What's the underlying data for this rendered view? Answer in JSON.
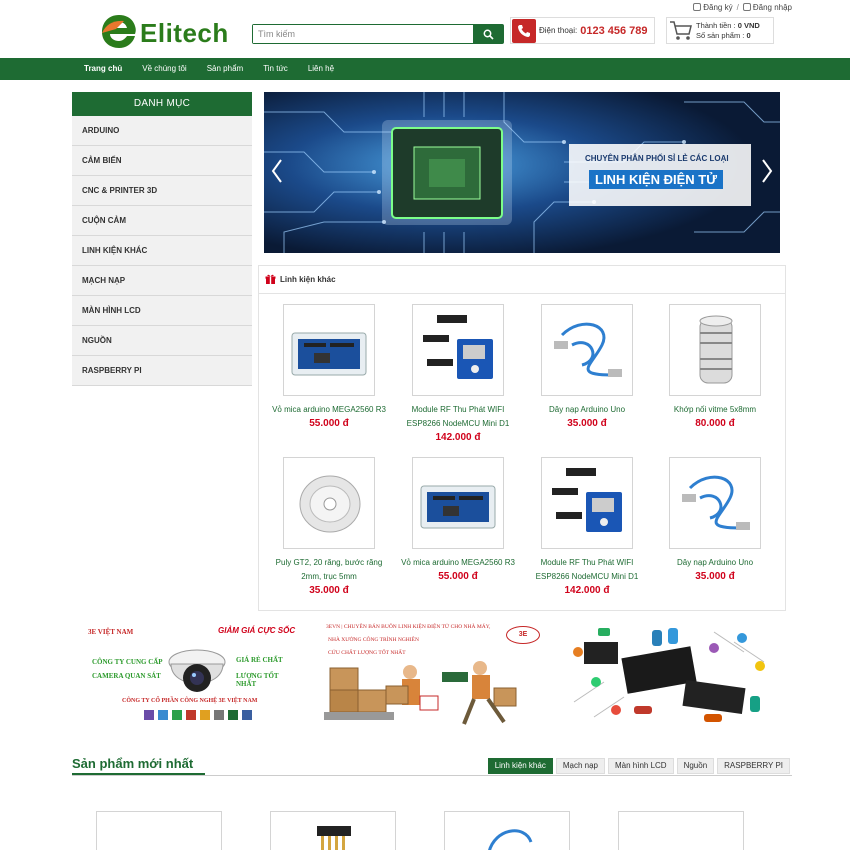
{
  "top_links": {
    "register": "Đăng ký",
    "separator": "/",
    "login": "Đăng nhập"
  },
  "header": {
    "logo_text": "Elitech",
    "search_placeholder": "Tìm kiếm",
    "phone_label": "Điện thoại:",
    "phone_number": "0123 456 789",
    "cart_total_label": "Thành tiền :",
    "cart_total_value": "0 VND",
    "cart_count_label": "Số sản phẩm :",
    "cart_count_value": "0"
  },
  "nav": [
    "Trang chủ",
    "Về chúng tôi",
    "Sản phẩm",
    "Tin tức",
    "Liên hệ"
  ],
  "sidebar": {
    "title": "DANH MỤC",
    "items": [
      "ARDUINO",
      "CẢM BIẾN",
      "CNC & PRINTER 3D",
      "CUỘN CẢM",
      "LINH KIỆN KHÁC",
      "MẠCH NẠP",
      "MÀN HÌNH LCD",
      "NGUỒN",
      "RASPBERRY PI"
    ]
  },
  "slider": {
    "subtitle": "CHUYÊN PHÂN PHỐI SỈ LẺ CÁC LOẠI",
    "title": "LINH KIỆN ĐIỆN TỬ"
  },
  "panel": {
    "title": "Linh kiện khác",
    "products": [
      {
        "name": "Vỏ mica arduino MEGA2560 R3",
        "price": "55.000 đ",
        "icon": "case-image"
      },
      {
        "name": "Module RF Thu Phát WIFI ESP8266 NodeMCU Mini D1",
        "price": "142.000 đ",
        "icon": "module-image"
      },
      {
        "name": "Dây nạp Arduino Uno",
        "price": "35.000 đ",
        "icon": "cable-image"
      },
      {
        "name": "Khớp nối vitme 5x8mm",
        "price": "80.000 đ",
        "icon": "coupler-image"
      },
      {
        "name": "Puly GT2, 20 răng, bước răng 2mm, trục 5mm",
        "price": "35.000 đ",
        "icon": "pulley-image"
      },
      {
        "name": "Vỏ mica arduino MEGA2560 R3",
        "price": "55.000 đ",
        "icon": "case-image"
      },
      {
        "name": "Module RF Thu Phát WIFI ESP8266 NodeMCU Mini D1",
        "price": "142.000 đ",
        "icon": "module-image"
      },
      {
        "name": "Dây nạp Arduino Uno",
        "price": "35.000 đ",
        "icon": "cable-image"
      }
    ]
  },
  "banner1": {
    "brand": "3E VIỆT NAM",
    "promo": "GIẢM GIÁ CỰC SỐC",
    "line1": "CÔNG TY CUNG CẤP",
    "line2": "CAMERA QUAN SÁT",
    "right1": "GIÁ RẺ CHẤT",
    "right2": "LƯỢNG TỐT NHẤT",
    "company": "CÔNG TY CỔ PHẦN CÔNG NGHỆ 3E VIỆT NAM"
  },
  "banner2": {
    "line1": "3EVN | CHUYÊN BÁN BUÔN LINH KIỆN ĐIỆN TỬ CHO NHÀ MÁY,",
    "line2": "NHÀ XƯỞNG CÔNG TRÌNH NGHIÊN",
    "line3": "CỨU CHẤT LƯỢNG TỐT NHẤT"
  },
  "new_products": {
    "title": "Sản phẩm mới nhất",
    "tabs": [
      "Linh kiện khác",
      "Mạch nạp",
      "Màn hình LCD",
      "Nguồn",
      "RASPBERRY PI"
    ]
  },
  "colors": {
    "primary": "#1e6b33",
    "price": "#d0021b",
    "phone": "#c62828"
  }
}
